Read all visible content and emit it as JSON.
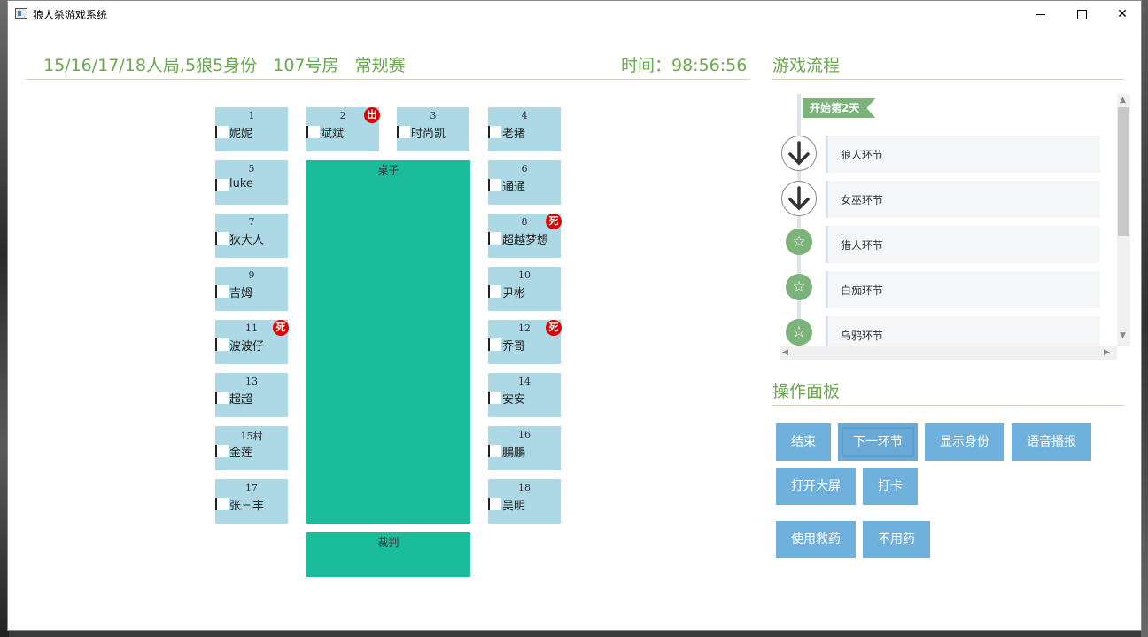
{
  "window": {
    "title": "狼人杀游戏系统",
    "minimize_glyph": "",
    "close_glyph": "✕"
  },
  "header": {
    "game_info": "15/16/17/18人局,5狼5身份   107号房   常规赛",
    "time": "时间：98:56:56"
  },
  "seats": [
    {
      "num": "1",
      "name": "妮妮",
      "badge": ""
    },
    {
      "num": "2",
      "name": "斌斌",
      "badge": "出"
    },
    {
      "num": "3",
      "name": "时尚凯",
      "badge": ""
    },
    {
      "num": "4",
      "name": "老猪",
      "badge": ""
    },
    {
      "num": "5",
      "name": "luke",
      "badge": ""
    },
    {
      "num": "6",
      "name": "通通",
      "badge": ""
    },
    {
      "num": "7",
      "name": "狄大人",
      "badge": ""
    },
    {
      "num": "8",
      "name": "超越梦想",
      "badge": "死"
    },
    {
      "num": "9",
      "name": "吉姆",
      "badge": ""
    },
    {
      "num": "10",
      "name": "尹彬",
      "badge": ""
    },
    {
      "num": "11",
      "name": "波波仔",
      "badge": "死"
    },
    {
      "num": "12",
      "name": "乔哥",
      "badge": "死"
    },
    {
      "num": "13",
      "name": "超超",
      "badge": ""
    },
    {
      "num": "14",
      "name": "安安",
      "badge": ""
    },
    {
      "num": "15村",
      "name": "金莲",
      "badge": ""
    },
    {
      "num": "16",
      "name": "鵬鵬",
      "badge": ""
    },
    {
      "num": "17",
      "name": "张三丰",
      "badge": ""
    },
    {
      "num": "18",
      "name": "吴明",
      "badge": ""
    }
  ],
  "table_label": "桌子",
  "judge_label": "裁判",
  "flow": {
    "title": "游戏流程",
    "day_tag": "开始第2天",
    "steps": [
      {
        "label": "狼人环节",
        "icon": "arrow-down-icon"
      },
      {
        "label": "女巫环节",
        "icon": "arrow-down-icon"
      },
      {
        "label": "猎人环节",
        "icon": "star-icon"
      },
      {
        "label": "白痴环节",
        "icon": "star-icon"
      },
      {
        "label": "乌鸦环节",
        "icon": "star-icon"
      }
    ]
  },
  "panel": {
    "title": "操作面板",
    "buttons": {
      "end": "结束",
      "next": "下一环节",
      "show_identity": "显示身份",
      "voice": "语音播报",
      "open_screen": "打开大屏",
      "check_in": "打卡",
      "use_antidote": "使用救药",
      "no_antidote": "不用药"
    }
  },
  "colors": {
    "accent_green": "#6aa84f",
    "seat_blue": "#add8e6",
    "table_teal": "#1abc9c",
    "button_blue": "#6fb0dd",
    "dead_badge_red": "#e00000"
  }
}
